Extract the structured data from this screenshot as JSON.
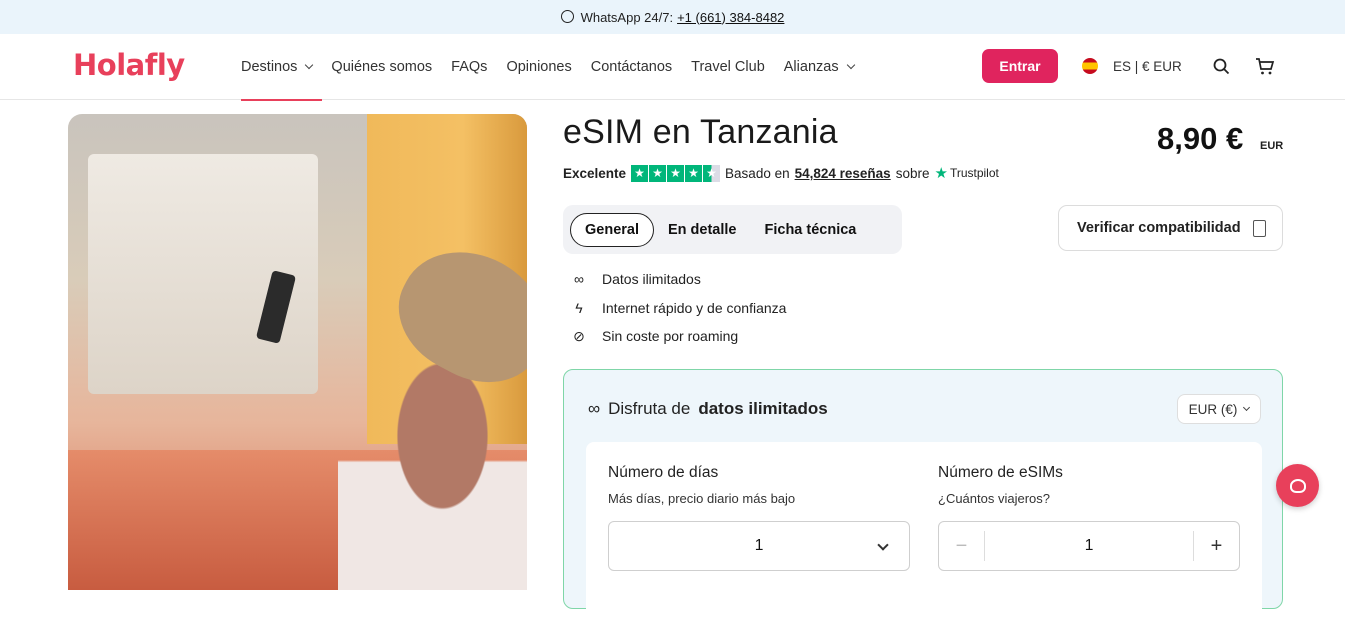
{
  "topbar": {
    "label": "WhatsApp 24/7:",
    "phone": "+1 (661) 384-8482"
  },
  "header": {
    "logo": "Holafly",
    "nav": [
      {
        "label": "Destinos",
        "has_dropdown": true,
        "active": true
      },
      {
        "label": "Quiénes somos"
      },
      {
        "label": "FAQs"
      },
      {
        "label": "Opiniones"
      },
      {
        "label": "Contáctanos"
      },
      {
        "label": "Travel Club"
      },
      {
        "label": "Alianzas",
        "has_dropdown": true
      }
    ],
    "login_label": "Entrar",
    "locale_label": "ES | € EUR",
    "accent_color": "#e0245e"
  },
  "product": {
    "title": "eSIM en Tanzania",
    "price": "8,90 €",
    "currency": "EUR",
    "rating": {
      "label": "Excelente",
      "stars": 4.5,
      "based_on": "Basado en",
      "reviews": "54,824 reseñas",
      "on": "sobre",
      "platform": "Trustpilot"
    },
    "tabs": [
      "General",
      "En detalle",
      "Ficha técnica"
    ],
    "active_tab": "General",
    "compat_label": "Verificar compatibilidad",
    "features": [
      {
        "icon": "infinity-icon",
        "label": "Datos ilimitados"
      },
      {
        "icon": "lightning-icon",
        "label": "Internet rápido y de confianza"
      },
      {
        "icon": "no-roaming-icon",
        "label": "Sin coste por roaming"
      }
    ]
  },
  "plan": {
    "title_prefix": "Disfruta de",
    "title_bold": "datos ilimitados",
    "currency_select": "EUR (€)",
    "days": {
      "label": "Número de días",
      "hint": "Más días, precio diario más bajo",
      "value": "1"
    },
    "esims": {
      "label": "Número de eSIMs",
      "hint": "¿Cuántos viajeros?",
      "value": "1",
      "minus": "−",
      "plus": "+"
    }
  }
}
